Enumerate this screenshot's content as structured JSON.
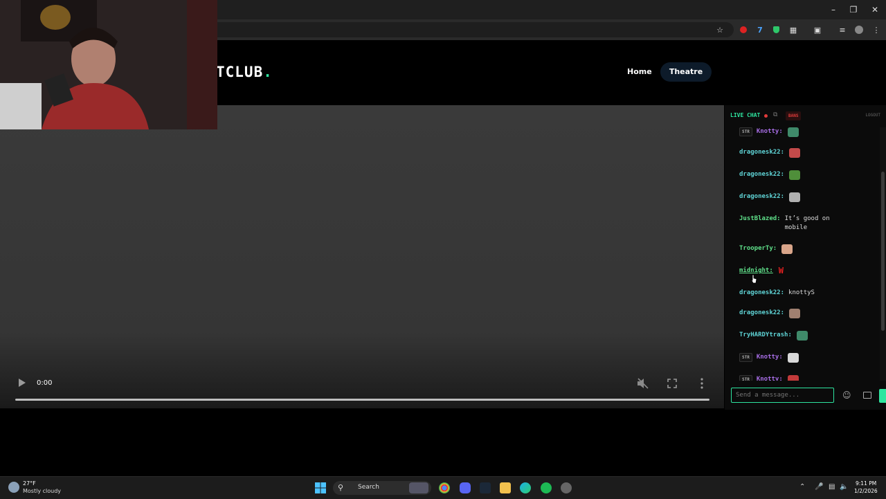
{
  "site": {
    "logo_text": "TCLUB",
    "logo_dot": ".",
    "nav": {
      "home": "Home",
      "theatre": "Theatre"
    }
  },
  "player": {
    "time": "0:00",
    "icons": {
      "play": "play-icon",
      "mute": "muted-icon",
      "fullscreen": "fullscreen-icon",
      "more": "more-vertical-icon"
    }
  },
  "chat": {
    "header": {
      "live_label": "LIVE CHAT",
      "bans": "BANS",
      "logout": "LOGOUT"
    },
    "messages": [
      {
        "badge": "STR",
        "user": "Knotty:",
        "text": "",
        "emote": true,
        "user_color": "#a86ee6",
        "emote_color": "#3f8a6a"
      },
      {
        "badge": "",
        "user": "dragonesk22:",
        "text": "",
        "emote": true,
        "user_color": "#5fd4d6",
        "emote_color": "#c44a4a"
      },
      {
        "badge": "",
        "user": "dragonesk22:",
        "text": "",
        "emote": true,
        "user_color": "#5fd4d6",
        "emote_color": "#4f8f3a"
      },
      {
        "badge": "",
        "user": "dragonesk22:",
        "text": "",
        "emote": true,
        "user_color": "#5fd4d6",
        "emote_color": "#b0b0b0"
      },
      {
        "badge": "",
        "user": "JustBlazed:",
        "text": "It’s good on mobile",
        "emote": false,
        "user_color": "#5fe08a"
      },
      {
        "badge": "",
        "user": "TrooperTy:",
        "text": "",
        "emote": true,
        "user_color": "#5fe08a",
        "emote_color": "#d9a58a"
      },
      {
        "badge": "",
        "user": "midnight:",
        "text": "W",
        "emote": false,
        "user_color": "#5fe08a",
        "text_color": "#e02020"
      },
      {
        "badge": "",
        "user": "dragonesk22:",
        "text": "knottyS",
        "emote": false,
        "user_color": "#5fd4d6"
      },
      {
        "badge": "",
        "user": "dragonesk22:",
        "text": "",
        "emote": true,
        "user_color": "#5fd4d6",
        "emote_color": "#a08070"
      },
      {
        "badge": "",
        "user": "TryHARDYtrash:",
        "text": "",
        "emote": true,
        "user_color": "#5fd4d6",
        "emote_color": "#3f8a6a"
      },
      {
        "badge": "STR",
        "user": "Knotty:",
        "text": "",
        "emote": true,
        "user_color": "#a86ee6",
        "emote_color": "#d8d8d8"
      },
      {
        "badge": "STR",
        "user": "Knotty:",
        "text": "",
        "emote": true,
        "user_color": "#a86ee6",
        "emote_color": "#c23a3a"
      }
    ],
    "input_placeholder": "Send a message..."
  },
  "taskbar": {
    "weather": {
      "temp": "27°F",
      "condition": "Mostly cloudy"
    },
    "search_label": "Search",
    "clock": {
      "time": "9:11 PM",
      "date": "1/2/2026"
    }
  },
  "colors": {
    "accent": "#2ee6a0",
    "live_dot": "#e23b3b"
  }
}
